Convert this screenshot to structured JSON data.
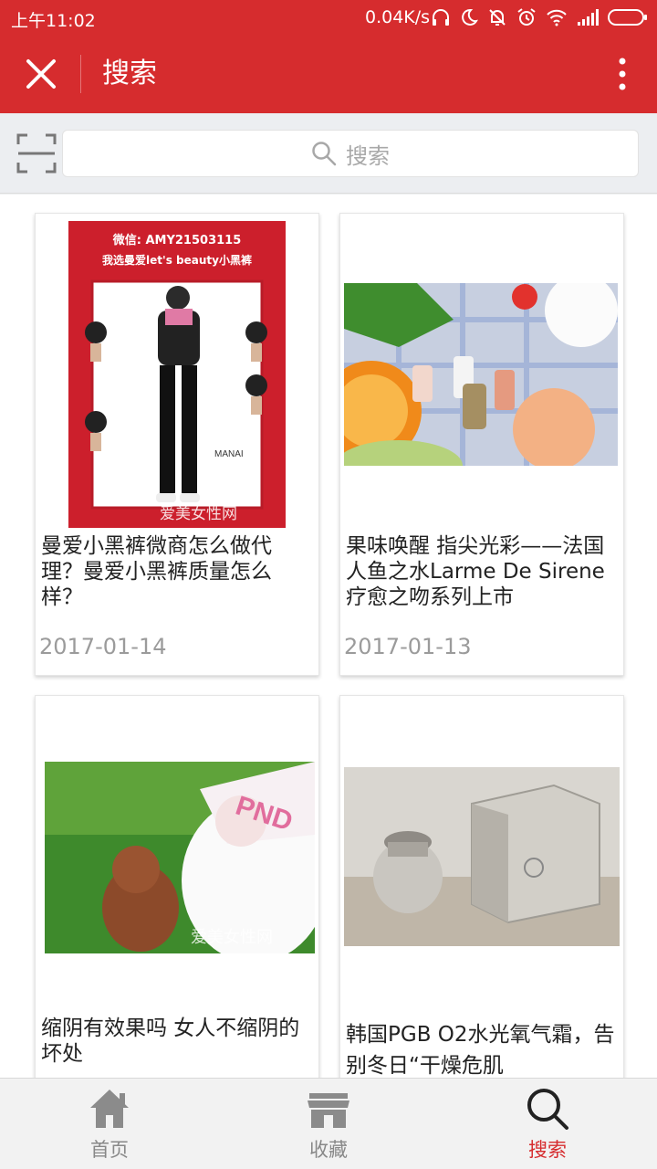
{
  "status_bar": {
    "time": "上午11:02",
    "net_speed": "0.04K/s",
    "icons": [
      "headphones-icon",
      "moon-icon",
      "bell-off-icon",
      "alarm-icon",
      "wifi-icon",
      "signal-icon",
      "battery-icon"
    ]
  },
  "header": {
    "title": "搜索",
    "close_icon": "close-icon",
    "more_icon": "more-vertical-icon",
    "background": "#d62c2e"
  },
  "search": {
    "placeholder": "搜索",
    "scan_icon": "scan-icon"
  },
  "cards": [
    {
      "title": "曼爱小黑裤微商怎么做代理？曼爱小黑裤质量怎么样？",
      "date": "2017-01-14",
      "image": {
        "wechat_text": "微信: AMY21503115",
        "headline": "我选曼爱let's beauty小黑裤",
        "watermark": "爱美女性网"
      }
    },
    {
      "title": "果味唤醒 指尖光彩——法国人鱼之水Larme De Sirene 疗愈之吻系列上市",
      "date": "2017-01-13"
    },
    {
      "title": "缩阴有效果吗 女人不缩阴的坏处",
      "date": "",
      "image": {
        "watermark": "爱美女性网"
      }
    },
    {
      "title": "韩国PGB O2水光氧气霜，告别冬日“干燥危肌",
      "date": ""
    }
  ],
  "tab_bar": {
    "active": 2,
    "tabs": [
      {
        "label": "首页",
        "icon": "home-icon"
      },
      {
        "label": "收藏",
        "icon": "store-icon"
      },
      {
        "label": "搜索",
        "icon": "search-icon"
      }
    ],
    "active_color": "#d62c2e",
    "inactive_color": "#888888"
  }
}
